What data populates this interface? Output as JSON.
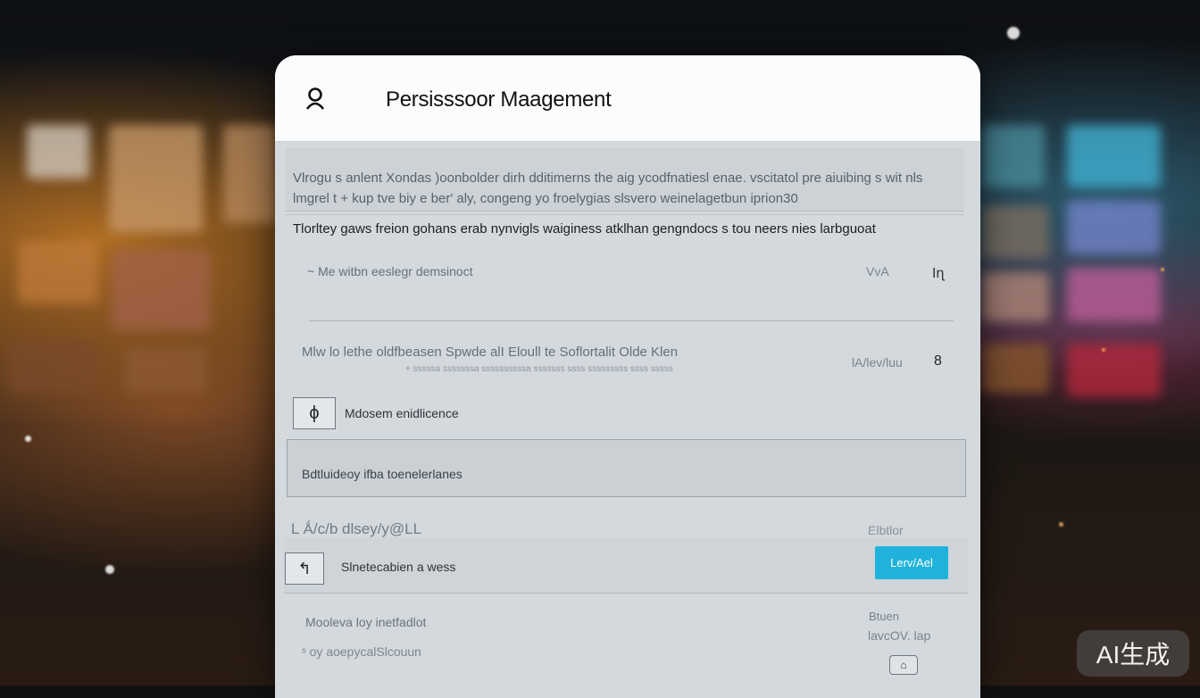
{
  "dialog": {
    "title": "Persisssoor Maagement",
    "intro_text": "Vlrogu s anlent Xondas )oonbolder dirh dditimerns the aig ycodfnatiesl enae. vscitatol pre aiuibing s wit nls lmgrel  t  + kup tve biy e ber' aly, congeng   yo froelygias slsvero weinelagetbun iprion30",
    "subheading": "Tlorltey gaws freion gohans erab nynvigls  waiginess atklhan gengndocs s tou  neers nies larbguoat"
  },
  "rows": {
    "row1": {
      "label": "~  Me witbn eeslegr demsinoct",
      "meta_a": "VvA",
      "meta_b": "Iɳ"
    },
    "row2": {
      "label": "Mlw lo lethe oldfbeasen Spwde alI Eloull te Soflortalit Olde Klen",
      "sub": "+ sssssa sssssssa ssssssssssa sssssss ssss sssssssss ssss sssss",
      "meta_a": "lA/lev/luu",
      "meta_b": "8"
    },
    "row3": {
      "label": "Mdosem enidlicence"
    },
    "row4": {
      "label": "Bdtluideoy ifba toenelerlanes"
    },
    "row5": {
      "label": "L Ǻ/c/b  dlsey/y@LL",
      "meta": "Elbtlor"
    },
    "row6": {
      "label": "Slnetecabien a wess",
      "button_label": "Lerv/Ael"
    },
    "row7": {
      "label": "Mooleva loy inetfadlot",
      "meta_a": "Btuen",
      "meta_b": "lavcOV. lap"
    },
    "row8": {
      "label": "ˢ oy aoepycalSlcouun"
    }
  },
  "watermark": "AI生成"
}
